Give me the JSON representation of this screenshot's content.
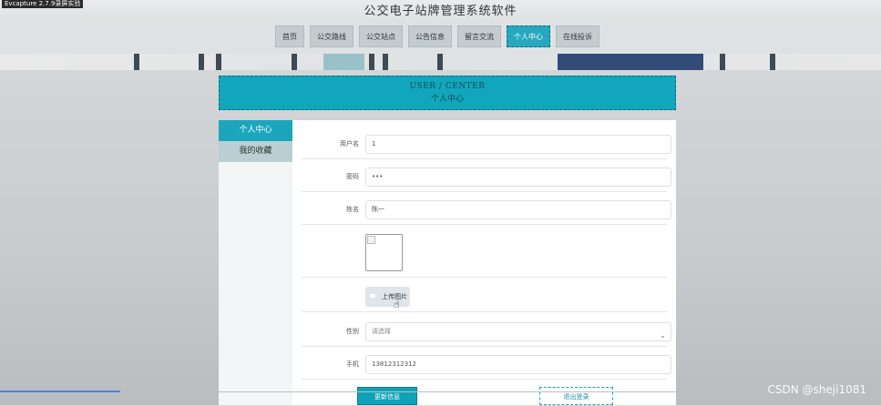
{
  "recording_label": "Evcapture 2.7.9录屏实验",
  "site_title": "公交电子站牌管理系统软件",
  "nav": {
    "items": [
      "首页",
      "公交路线",
      "公交站点",
      "公告信息",
      "留言交流",
      "个人中心",
      "在线投诉"
    ],
    "active_index": 5
  },
  "user_center": {
    "title_en": "USER / CENTER",
    "title_cn": "个人中心"
  },
  "sidebar": {
    "items": [
      "个人中心",
      "我的收藏"
    ]
  },
  "form": {
    "username": {
      "label": "用户名",
      "value": "1"
    },
    "password": {
      "label": "密码",
      "value": "•••"
    },
    "name": {
      "label": "姓名",
      "value": "陈一"
    },
    "upload_button": "上传图片",
    "gender": {
      "label": "性别",
      "placeholder": "请选择"
    },
    "phone": {
      "label": "手机",
      "value": "13812312312"
    },
    "update_button": "更新信息",
    "logout_button": "退出登录"
  },
  "watermark": "CSDN @sheji1081",
  "colors": {
    "accent": "#12a6bd",
    "nav_active": "#27a8bf"
  }
}
